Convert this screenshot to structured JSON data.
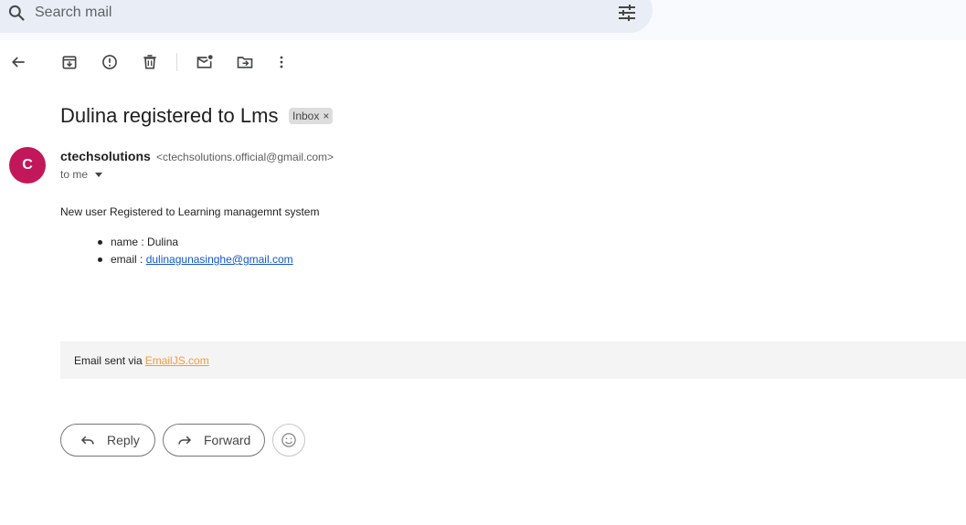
{
  "search": {
    "placeholder": "Search mail"
  },
  "toolbar": {
    "icons": [
      "back-arrow-icon",
      "archive-icon",
      "report-spam-icon",
      "delete-icon",
      "mark-unread-icon",
      "move-to-icon",
      "more-vert-icon"
    ]
  },
  "email": {
    "subject": "Dulina registered to Lms",
    "label": "Inbox",
    "label_close": "×",
    "sender": {
      "initial": "C",
      "name": "ctechsolutions",
      "email": "<ctechsolutions.official@gmail.com>",
      "avatar_color": "#c2185b"
    },
    "recipient": "to me",
    "body": {
      "intro": "New user Registered to Learning managemnt system",
      "name_prefix": "name : ",
      "name_value": "Dulina",
      "email_prefix": "email : ",
      "email_value": "dulinagunasinghe@gmail.com"
    },
    "footer": {
      "prefix": "Email sent via",
      "link": "EmailJS.com",
      "link_color": "#f79a3e"
    }
  },
  "actions": {
    "reply": "Reply",
    "forward": "Forward"
  }
}
